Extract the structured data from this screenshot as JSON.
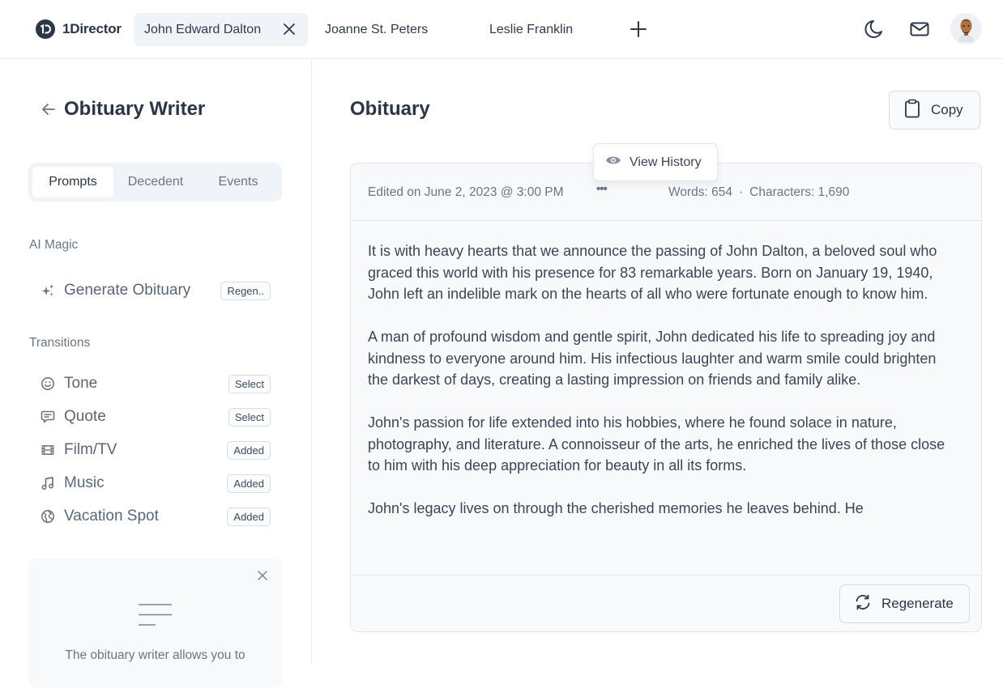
{
  "app": {
    "name": "1Director",
    "logo_icon": "1d-logo-icon"
  },
  "tabs": [
    {
      "label": "John Edward Dalton",
      "active": true,
      "close_icon": "close-icon"
    },
    {
      "label": "Joanne St. Peters",
      "active": false
    },
    {
      "label": "Leslie Franklin",
      "active": false
    }
  ],
  "topbar": {
    "add_tab_icon": "plus-icon",
    "theme_icon": "moon-icon",
    "mail_icon": "mail-icon",
    "avatar": "user-avatar"
  },
  "sidebar": {
    "title": "Obituary Writer",
    "back_icon": "arrow-left-icon",
    "segments": [
      {
        "label": "Prompts",
        "active": true
      },
      {
        "label": "Decedent",
        "active": false
      },
      {
        "label": "Events",
        "active": false
      }
    ],
    "ai_magic": {
      "label": "AI Magic",
      "items": [
        {
          "icon": "sparkles-icon",
          "label": "Generate Obituary",
          "badge": "Regen.."
        }
      ]
    },
    "transitions": {
      "label": "Transitions",
      "items": [
        {
          "icon": "smiley-icon",
          "label": "Tone",
          "badge": "Select"
        },
        {
          "icon": "chat-quote-icon",
          "label": "Quote",
          "badge": "Select"
        },
        {
          "icon": "film-icon",
          "label": "Film/TV",
          "badge": "Added"
        },
        {
          "icon": "music-note-icon",
          "label": "Music",
          "badge": "Added"
        },
        {
          "icon": "globe-icon",
          "label": "Vacation Spot",
          "badge": "Added"
        }
      ]
    },
    "info_card": {
      "close_icon": "close-icon",
      "illustration_icon": "text-lines-icon",
      "text": "The obituary writer allows you to"
    }
  },
  "main": {
    "title": "Obituary",
    "copy_label": "Copy",
    "copy_icon": "clipboard-icon",
    "tooltip": {
      "icon": "eye-icon",
      "label": "View History"
    },
    "meta": {
      "edited": "Edited on June 2, 2023 @ 3:00 PM",
      "more_icon": "ellipsis-icon",
      "more": "•••",
      "words": "Words: 654",
      "separator": "·",
      "characters": "Characters: 1,690"
    },
    "paragraphs": [
      "It is with heavy hearts that we announce the passing of John Dalton, a beloved soul who graced this world with his presence for 83 remarkable years. Born on January 19, 1940, John left an indelible mark on the hearts of all who were fortunate enough to know him.",
      "A man of profound wisdom and gentle spirit, John dedicated his life to spreading joy and kindness to everyone around him. His infectious laughter and warm smile could brighten the darkest of days, creating a lasting impression on friends and family alike.",
      "John's passion for life extended into his hobbies, where he found solace in nature, photography, and literature. A connoisseur of the arts, he enriched the lives of those close to him with his deep appreciation for beauty in all its forms.",
      "John's legacy lives on through the cherished memories he leaves behind. He"
    ],
    "regenerate_label": "Regenerate",
    "regenerate_icon": "refresh-icon"
  },
  "colors": {
    "text_dark": "#2b3648",
    "text_muted": "#6b7585",
    "tab_active_bg": "#f0f4f9",
    "editor_bg": "#f8f9fb",
    "border": "#e3e7ed"
  }
}
